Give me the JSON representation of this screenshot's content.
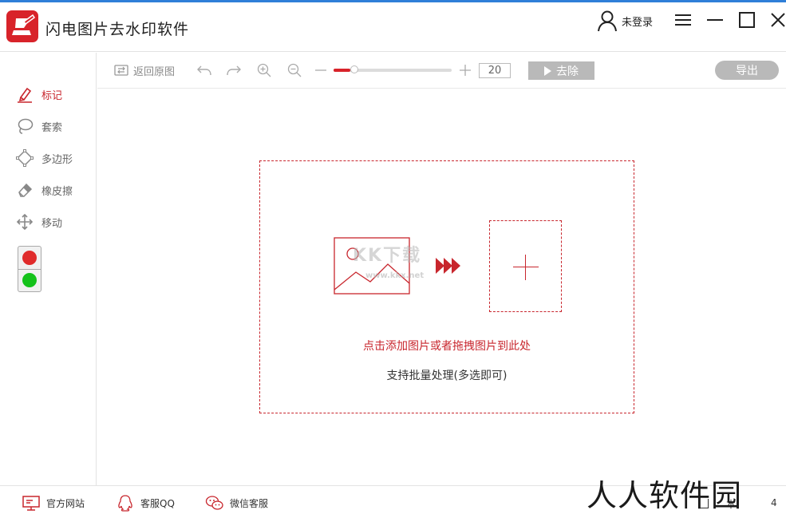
{
  "app": {
    "title": "闪电图片去水印软件",
    "login_label": "未登录"
  },
  "window_controls": [
    "menu-icon",
    "minimize-icon",
    "maximize-icon",
    "close-icon"
  ],
  "sidebar": {
    "tools": [
      {
        "label": "标记",
        "icon": "marker-icon",
        "active": true
      },
      {
        "label": "套索",
        "icon": "lasso-icon",
        "active": false
      },
      {
        "label": "多边形",
        "icon": "polygon-icon",
        "active": false
      },
      {
        "label": "橡皮擦",
        "icon": "eraser-icon",
        "active": false
      },
      {
        "label": "移动",
        "icon": "move-icon",
        "active": false
      }
    ],
    "color_toggle": [
      "#e02b2b",
      "#14c21a"
    ]
  },
  "toolbar": {
    "restore_label": "返回原图",
    "brush_size": "20",
    "brush_level": 0.14,
    "remove_label": "去除",
    "export_label": "导出"
  },
  "dropzone": {
    "hint": "点击添加图片或者拖拽图片到此处",
    "sub": "支持批量处理(多选即可)",
    "watermark": "KK下载",
    "watermark_url": "www.kkx.net"
  },
  "statusbar": {
    "links": [
      {
        "label": "官方网站",
        "icon": "monitor-icon"
      },
      {
        "label": "客服QQ",
        "icon": "qq-icon"
      },
      {
        "label": "微信客服",
        "icon": "wechat-icon"
      }
    ],
    "watermark": "人人软件园",
    "fragment_left": "本",
    "fragment_right": "4"
  },
  "colors": {
    "accent": "#c8262d",
    "brand": "#d8232a",
    "disabled_button": "#b9b9b9",
    "title_bar_line": "#2f7fd8"
  }
}
